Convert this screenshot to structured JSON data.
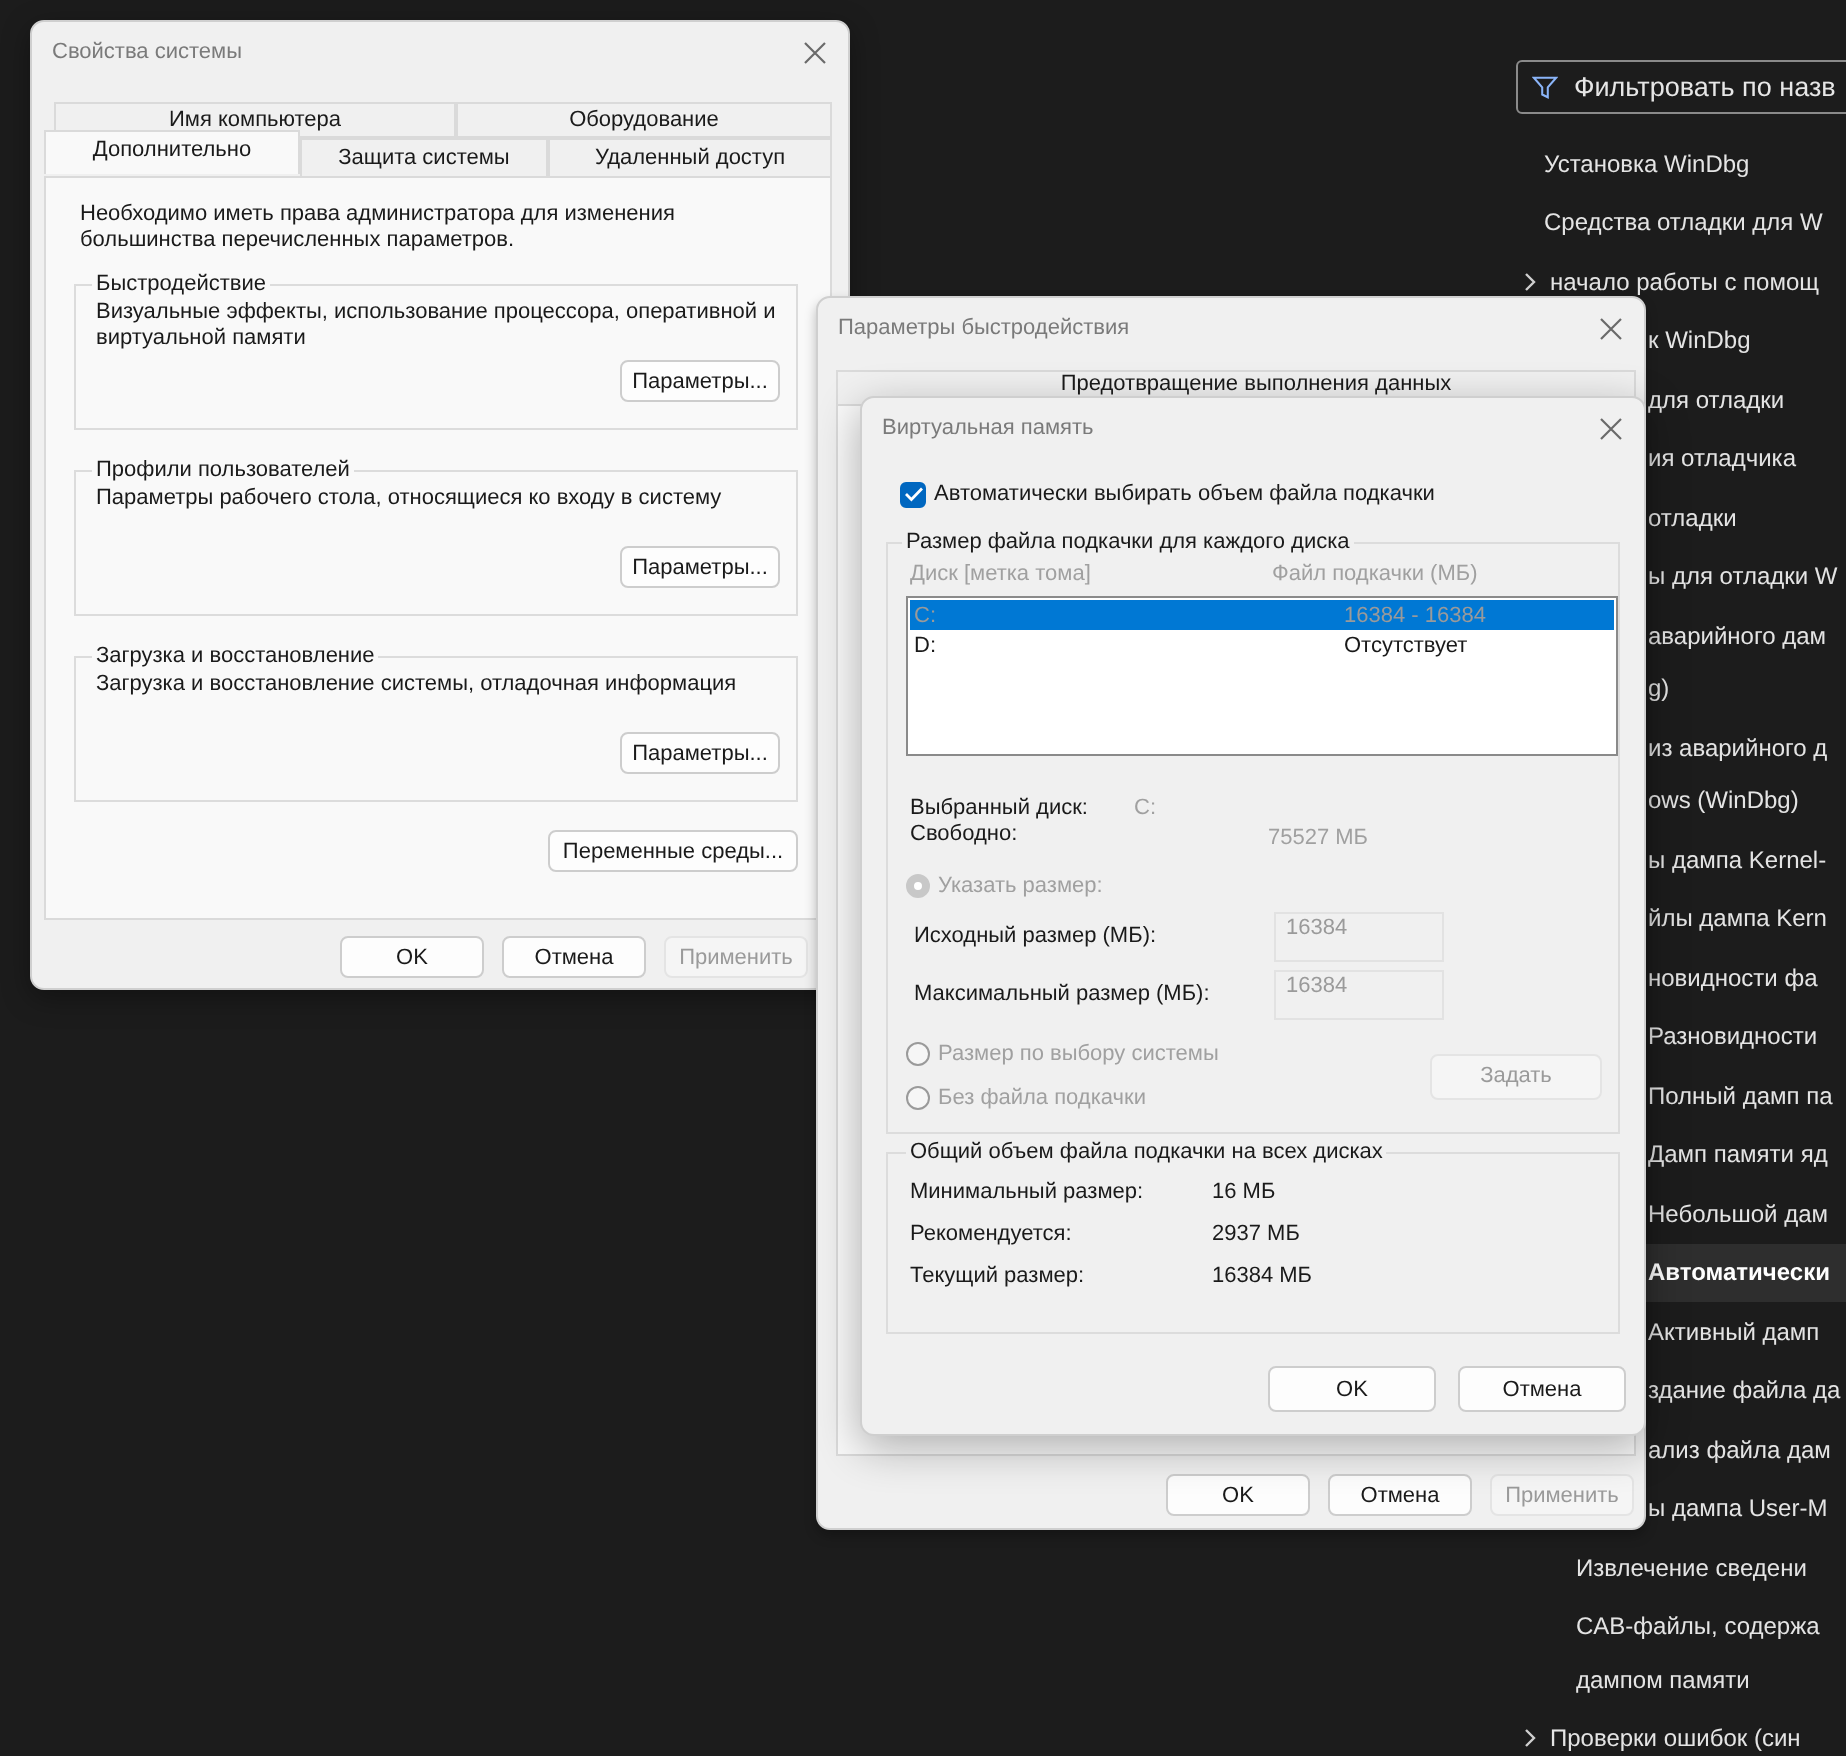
{
  "sidebar": {
    "filter": {
      "placeholder": "Фильтровать по назв"
    },
    "items": [
      {
        "kind": "item",
        "lines": [
          "Установка WinDbg"
        ],
        "selected": false
      },
      {
        "kind": "item",
        "lines": [
          "Средства отладки для W"
        ],
        "selected": false
      },
      {
        "kind": "expander",
        "lines": [
          "начало работы с помощ"
        ],
        "selected": false
      },
      {
        "kind": "clipped",
        "lines": [
          "к WinDbg"
        ],
        "selected": false
      },
      {
        "kind": "clipped",
        "lines": [
          "для отладки"
        ],
        "selected": false
      },
      {
        "kind": "clipped",
        "lines": [
          "ия отладчика"
        ],
        "selected": false
      },
      {
        "kind": "clipped",
        "lines": [
          "отладки"
        ],
        "selected": false
      },
      {
        "kind": "clipped",
        "lines": [
          "ы для отладки W"
        ],
        "selected": false
      },
      {
        "kind": "clipped",
        "lines": [
          "аварийного дам",
          "g)"
        ],
        "selected": false
      },
      {
        "kind": "clipped",
        "lines": [
          "из аварийного д",
          "ows (WinDbg)"
        ],
        "selected": false
      },
      {
        "kind": "clipped",
        "lines": [
          "ы дампа Kernel-"
        ],
        "selected": false
      },
      {
        "kind": "clipped",
        "lines": [
          "йлы дампа Kern"
        ],
        "selected": false
      },
      {
        "kind": "clipped",
        "lines": [
          "новидности фа"
        ],
        "selected": false
      },
      {
        "kind": "clipped",
        "lines": [
          "Разновидности"
        ],
        "selected": false
      },
      {
        "kind": "clipped",
        "lines": [
          "Полный дамп па"
        ],
        "selected": false
      },
      {
        "kind": "clipped",
        "lines": [
          "Дамп памяти яд"
        ],
        "selected": false
      },
      {
        "kind": "clipped",
        "lines": [
          "Небольшой дам"
        ],
        "selected": false
      },
      {
        "kind": "clipped",
        "lines": [
          "Автоматически"
        ],
        "selected": true
      },
      {
        "kind": "clipped",
        "lines": [
          "Активный дамп"
        ],
        "selected": false
      },
      {
        "kind": "clipped",
        "lines": [
          "здание файла да"
        ],
        "selected": false
      },
      {
        "kind": "clipped",
        "lines": [
          "ализ файла дам"
        ],
        "selected": false
      },
      {
        "kind": "clipped",
        "lines": [
          "ы дампа User-M"
        ],
        "selected": false
      },
      {
        "kind": "sub",
        "lines": [
          "Извлечение сведени"
        ],
        "selected": false
      },
      {
        "kind": "sub",
        "lines": [
          "CAB-файлы, содержа",
          "дампом памяти"
        ],
        "selected": false
      },
      {
        "kind": "expander",
        "lines": [
          "Проверки ошибок (син"
        ],
        "selected": false
      }
    ]
  },
  "system_properties": {
    "title": "Свойства системы",
    "tabs_back": [
      {
        "label": "Имя компьютера",
        "selected": false
      },
      {
        "label": "Оборудование",
        "selected": false
      }
    ],
    "tabs_front": [
      {
        "label": "Дополнительно",
        "selected": true
      },
      {
        "label": "Защита системы",
        "selected": false
      },
      {
        "label": "Удаленный доступ",
        "selected": false
      }
    ],
    "note": "Необходимо иметь права администратора для изменения большинства перечисленных параметров.",
    "groups": [
      {
        "title": "Быстродействие",
        "text": "Визуальные эффекты, использование процессора, оперативной и виртуальной памяти",
        "button": "Параметры..."
      },
      {
        "title": "Профили пользователей",
        "text": "Параметры рабочего стола, относящиеся ко входу в систему",
        "button": "Параметры..."
      },
      {
        "title": "Загрузка и восстановление",
        "text": "Загрузка и восстановление системы, отладочная информация",
        "button": "Параметры..."
      }
    ],
    "env_button": "Переменные среды...",
    "buttons": [
      {
        "label": "OK",
        "disabled": false
      },
      {
        "label": "Отмена",
        "disabled": false
      },
      {
        "label": "Применить",
        "disabled": true
      }
    ]
  },
  "performance_options": {
    "title": "Параметры быстродействия",
    "tab": "Предотвращение выполнения данных",
    "buttons": [
      {
        "label": "OK",
        "disabled": false
      },
      {
        "label": "Отмена",
        "disabled": false
      },
      {
        "label": "Применить",
        "disabled": true
      }
    ]
  },
  "virtual_memory": {
    "title": "Виртуальная память",
    "auto": {
      "label": "Автоматически выбирать объем файла подкачки",
      "checked": true
    },
    "per_disk": {
      "title": "Размер файла подкачки для каждого диска",
      "disabled": true,
      "columns": [
        "Диск [метка тома]",
        "Файл подкачки (МБ)"
      ],
      "drives": [
        {
          "drive": "C:",
          "size": "16384 - 16384",
          "selected": true
        },
        {
          "drive": "D:",
          "size": "Отсутствует",
          "selected": false
        }
      ],
      "selected_drive_label": "Выбранный диск:",
      "selected_drive": "C:",
      "free_label": "Свободно:",
      "free_value": "75527 МБ",
      "options": [
        {
          "kind": "custom",
          "label": "Указать размер:",
          "selected": true
        },
        {
          "kind": "system",
          "label": "Размер по выбору системы",
          "selected": false
        },
        {
          "kind": "none",
          "label": "Без файла подкачки",
          "selected": false
        }
      ],
      "initial_label": "Исходный размер (МБ):",
      "initial_value": "16384",
      "max_label": "Максимальный размер (МБ):",
      "max_value": "16384",
      "set_button": "Задать"
    },
    "totals": {
      "title": "Общий объем файла подкачки на всех дисках",
      "rows": [
        {
          "label": "Минимальный размер:",
          "value": "16 МБ"
        },
        {
          "label": "Рекомендуется:",
          "value": "2937 МБ"
        },
        {
          "label": "Текущий размер:",
          "value": "16384 МБ"
        }
      ]
    },
    "buttons": [
      {
        "label": "OK",
        "disabled": false
      },
      {
        "label": "Отмена",
        "disabled": false
      }
    ]
  }
}
